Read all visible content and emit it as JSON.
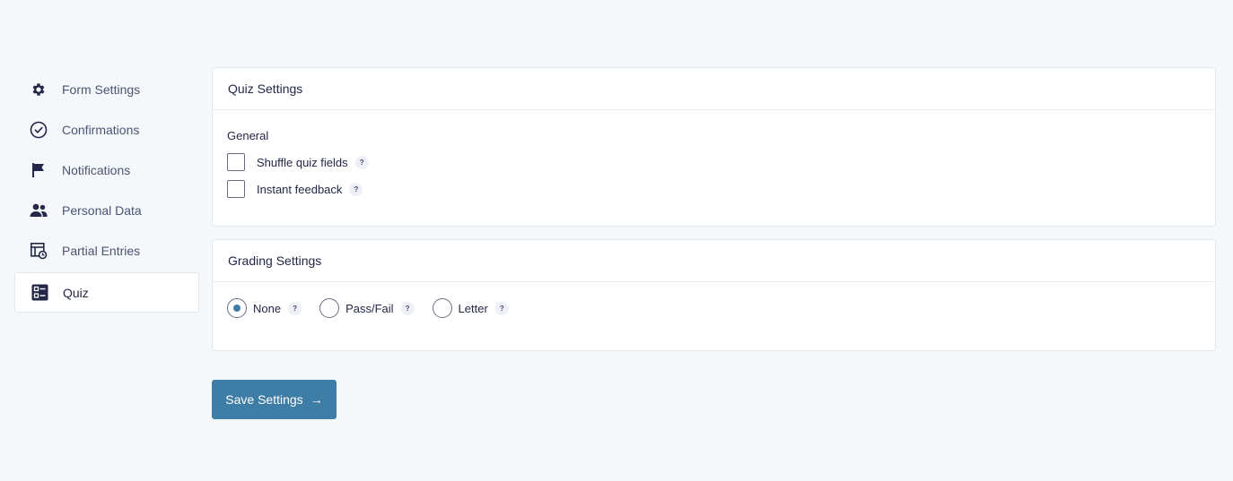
{
  "sidebar": {
    "items": [
      {
        "label": "Form Settings",
        "icon": "gear-icon"
      },
      {
        "label": "Confirmations",
        "icon": "check-circle-icon"
      },
      {
        "label": "Notifications",
        "icon": "flag-icon"
      },
      {
        "label": "Personal Data",
        "icon": "users-icon"
      },
      {
        "label": "Partial Entries",
        "icon": "partial-entries-icon"
      },
      {
        "label": "Quiz",
        "icon": "quiz-icon",
        "active": true
      }
    ]
  },
  "quiz_settings": {
    "title": "Quiz Settings",
    "section_label": "General",
    "options": [
      {
        "label": "Shuffle quiz fields",
        "checked": false,
        "help": "?"
      },
      {
        "label": "Instant feedback",
        "checked": false,
        "help": "?"
      }
    ]
  },
  "grading_settings": {
    "title": "Grading Settings",
    "options": [
      {
        "label": "None",
        "selected": true,
        "help": "?"
      },
      {
        "label": "Pass/Fail",
        "selected": false,
        "help": "?"
      },
      {
        "label": "Letter",
        "selected": false,
        "help": "?"
      }
    ]
  },
  "save_button": {
    "label": "Save Settings",
    "arrow": "→"
  },
  "colors": {
    "accent": "#3e7da6",
    "background": "#f5f8fa",
    "text": "#242748"
  }
}
